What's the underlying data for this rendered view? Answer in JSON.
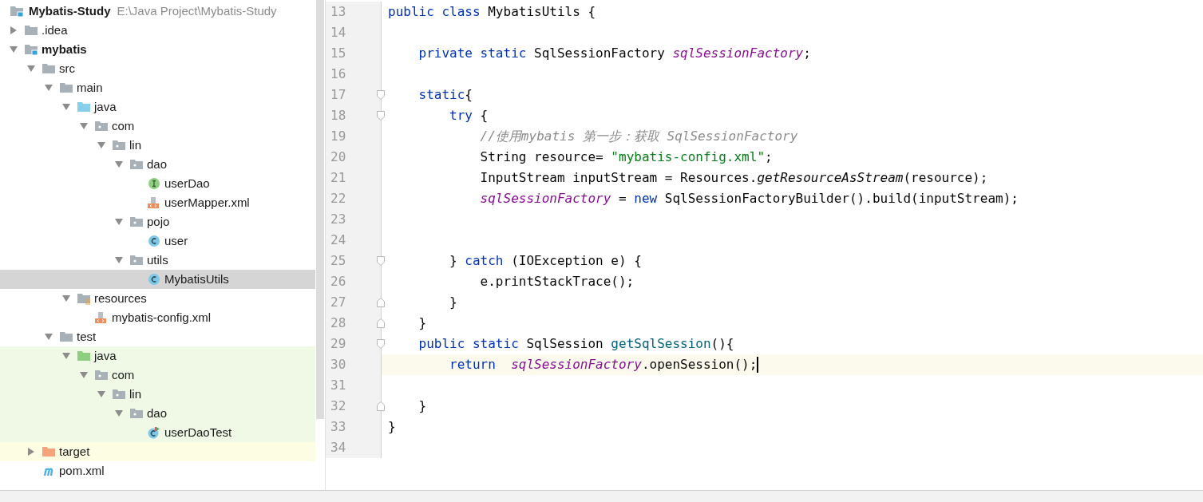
{
  "project": {
    "name": "Mybatis-Study",
    "path": "E:\\Java Project\\Mybatis-Study",
    "kind": "module"
  },
  "tree": [
    {
      "name": ".idea",
      "kind": "folder",
      "expanded": false,
      "selected": false
    },
    {
      "name": "mybatis",
      "kind": "module",
      "expanded": true,
      "selected": false,
      "children": [
        {
          "name": "src",
          "kind": "folder",
          "expanded": true,
          "selected": false,
          "children": [
            {
              "name": "main",
              "kind": "folder",
              "expanded": true,
              "selected": false,
              "children": [
                {
                  "name": "java",
                  "kind": "source-root",
                  "expanded": true,
                  "selected": false,
                  "children": [
                    {
                      "name": "com",
                      "kind": "package",
                      "expanded": true,
                      "selected": false,
                      "children": [
                        {
                          "name": "lin",
                          "kind": "package",
                          "expanded": true,
                          "selected": false,
                          "children": [
                            {
                              "name": "dao",
                              "kind": "package",
                              "expanded": true,
                              "selected": false,
                              "children": [
                                {
                                  "name": "userDao",
                                  "kind": "interface",
                                  "selected": false
                                },
                                {
                                  "name": "userMapper.xml",
                                  "kind": "xml",
                                  "selected": false
                                }
                              ]
                            },
                            {
                              "name": "pojo",
                              "kind": "package",
                              "expanded": true,
                              "selected": false,
                              "children": [
                                {
                                  "name": "user",
                                  "kind": "class",
                                  "selected": false
                                }
                              ]
                            },
                            {
                              "name": "utils",
                              "kind": "package",
                              "expanded": true,
                              "selected": false,
                              "children": [
                                {
                                  "name": "MybatisUtils",
                                  "kind": "class",
                                  "selected": true
                                }
                              ]
                            }
                          ]
                        }
                      ]
                    }
                  ]
                },
                {
                  "name": "resources",
                  "kind": "resources",
                  "expanded": true,
                  "selected": false,
                  "children": [
                    {
                      "name": "mybatis-config.xml",
                      "kind": "xml",
                      "selected": false
                    }
                  ]
                }
              ]
            },
            {
              "name": "test",
              "kind": "folder",
              "expanded": true,
              "selected": false,
              "children": [
                {
                  "name": "java",
                  "kind": "test-root",
                  "expanded": true,
                  "selected": false,
                  "children": [
                    {
                      "name": "com",
                      "kind": "package",
                      "expanded": true,
                      "selected": false,
                      "children": [
                        {
                          "name": "lin",
                          "kind": "package",
                          "expanded": true,
                          "selected": false,
                          "children": [
                            {
                              "name": "dao",
                              "kind": "package",
                              "expanded": true,
                              "selected": false,
                              "children": [
                                {
                                  "name": "userDaoTest",
                                  "kind": "test-class",
                                  "selected": false
                                }
                              ]
                            }
                          ]
                        }
                      ]
                    }
                  ]
                }
              ]
            }
          ]
        },
        {
          "name": "target",
          "kind": "excluded",
          "expanded": false,
          "selected": false
        },
        {
          "name": "pom.xml",
          "kind": "maven",
          "selected": false
        }
      ]
    }
  ],
  "editor": {
    "lines": [
      {
        "number": "13",
        "current": false,
        "tokens": [
          {
            "kind": "keyword",
            "text": "public class "
          },
          {
            "kind": "plain",
            "text": "MybatisUtils {"
          }
        ]
      },
      {
        "number": "14",
        "current": false
      },
      {
        "number": "15",
        "current": false,
        "tokens": [
          {
            "kind": "keyword",
            "text": "    private static "
          },
          {
            "kind": "plain",
            "text": "SqlSessionFactory "
          },
          {
            "kind": "field",
            "text": "sqlSessionFactory"
          },
          {
            "kind": "plain",
            "text": ";"
          }
        ]
      },
      {
        "number": "16",
        "current": false
      },
      {
        "number": "17",
        "current": false,
        "kind": "fold-start",
        "tokens": [
          {
            "kind": "keyword",
            "text": "    static"
          },
          {
            "kind": "plain",
            "text": "{"
          }
        ]
      },
      {
        "number": "18",
        "current": false,
        "kind": "fold-start",
        "tokens": [
          {
            "kind": "keyword",
            "text": "        try "
          },
          {
            "kind": "plain",
            "text": "{"
          }
        ]
      },
      {
        "number": "19",
        "current": false,
        "tokens": [
          {
            "kind": "comment",
            "text": "            //使用mybatis 第一步：获取 SqlSessionFactory"
          }
        ]
      },
      {
        "number": "20",
        "current": false,
        "tokens": [
          {
            "kind": "plain",
            "text": "            String resource= "
          },
          {
            "kind": "string",
            "text": "\"mybatis-config.xml\""
          },
          {
            "kind": "plain",
            "text": ";"
          }
        ]
      },
      {
        "number": "21",
        "current": false,
        "tokens": [
          {
            "kind": "plain",
            "text": "            InputStream inputStream = Resources."
          },
          {
            "kind": "static-call",
            "text": "getResourceAsStream"
          },
          {
            "kind": "plain",
            "text": "(resource);"
          }
        ]
      },
      {
        "number": "22",
        "current": false,
        "tokens": [
          {
            "kind": "field",
            "text": "            sqlSessionFactory"
          },
          {
            "kind": "plain",
            "text": " = "
          },
          {
            "kind": "keyword",
            "text": "new "
          },
          {
            "kind": "plain",
            "text": "SqlSessionFactoryBuilder().build(inputStream);"
          }
        ]
      },
      {
        "number": "23",
        "current": false
      },
      {
        "number": "24",
        "current": false
      },
      {
        "number": "25",
        "current": false,
        "kind": "fold-start",
        "tokens": [
          {
            "kind": "plain",
            "text": "        } "
          },
          {
            "kind": "keyword",
            "text": "catch "
          },
          {
            "kind": "plain",
            "text": "(IOException e) {"
          }
        ]
      },
      {
        "number": "26",
        "current": false,
        "tokens": [
          {
            "kind": "plain",
            "text": "            e.printStackTrace();"
          }
        ]
      },
      {
        "number": "27",
        "current": false,
        "kind": "fold-end",
        "tokens": [
          {
            "kind": "plain",
            "text": "        }"
          }
        ]
      },
      {
        "number": "28",
        "current": false,
        "kind": "fold-end",
        "tokens": [
          {
            "kind": "plain",
            "text": "    }"
          }
        ]
      },
      {
        "number": "29",
        "current": false,
        "kind": "fold-start",
        "tokens": [
          {
            "kind": "keyword",
            "text": "    public static "
          },
          {
            "kind": "plain",
            "text": "SqlSession "
          },
          {
            "kind": "method",
            "text": "getSqlSession"
          },
          {
            "kind": "plain",
            "text": "(){"
          }
        ]
      },
      {
        "number": "30",
        "current": true,
        "tokens": [
          {
            "kind": "keyword",
            "text": "        return  "
          },
          {
            "kind": "field",
            "text": "sqlSessionFactory"
          },
          {
            "kind": "plain",
            "text": ".openSession();"
          }
        ]
      },
      {
        "number": "31",
        "current": false
      },
      {
        "number": "32",
        "current": false,
        "kind": "fold-end",
        "tokens": [
          {
            "kind": "plain",
            "text": "    }"
          }
        ]
      },
      {
        "number": "33",
        "current": false,
        "tokens": [
          {
            "kind": "plain",
            "text": "}"
          }
        ]
      },
      {
        "number": "34",
        "current": false
      }
    ]
  }
}
